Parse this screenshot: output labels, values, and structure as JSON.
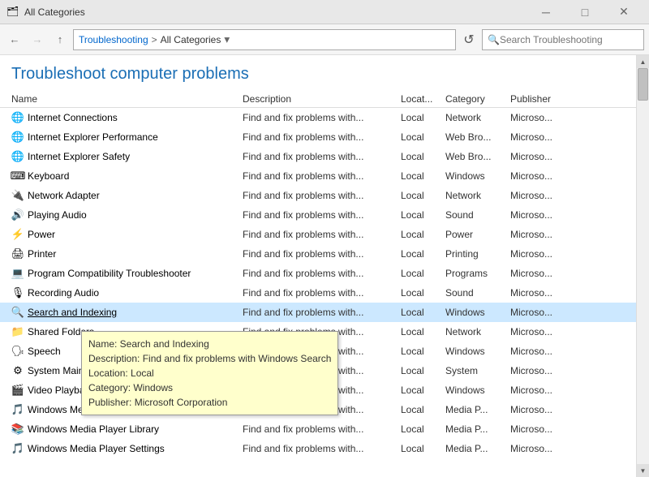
{
  "titleBar": {
    "icon": "🗂",
    "title": "All Categories",
    "minBtn": "─",
    "maxBtn": "□",
    "closeBtn": "✕"
  },
  "addressBar": {
    "backBtn": "←",
    "forwardBtn": "→",
    "upBtn": "↑",
    "breadcrumb": {
      "path1": "Troubleshooting",
      "sep": ">",
      "path2": "All Categories"
    },
    "dropdownBtn": "▾",
    "refreshBtn": "↺",
    "searchPlaceholder": "Search Troubleshooting"
  },
  "pageTitle": "Troubleshoot computer problems",
  "columns": {
    "name": "Name",
    "description": "Description",
    "location": "Locat...",
    "category": "Category",
    "publisher": "Publisher"
  },
  "items": [
    {
      "icon": "🌐",
      "name": "Internet Connections",
      "desc": "Find and fix problems with...",
      "loc": "Local",
      "cat": "Network",
      "pub": "Microso..."
    },
    {
      "icon": "🌐",
      "name": "Internet Explorer Performance",
      "desc": "Find and fix problems with...",
      "loc": "Local",
      "cat": "Web Bro...",
      "pub": "Microso..."
    },
    {
      "icon": "🌐",
      "name": "Internet Explorer Safety",
      "desc": "Find and fix problems with...",
      "loc": "Local",
      "cat": "Web Bro...",
      "pub": "Microso..."
    },
    {
      "icon": "⌨",
      "name": "Keyboard",
      "desc": "Find and fix problems with...",
      "loc": "Local",
      "cat": "Windows",
      "pub": "Microso..."
    },
    {
      "icon": "🔌",
      "name": "Network Adapter",
      "desc": "Find and fix problems with...",
      "loc": "Local",
      "cat": "Network",
      "pub": "Microso..."
    },
    {
      "icon": "🔊",
      "name": "Playing Audio",
      "desc": "Find and fix problems with...",
      "loc": "Local",
      "cat": "Sound",
      "pub": "Microso..."
    },
    {
      "icon": "⚡",
      "name": "Power",
      "desc": "Find and fix problems with...",
      "loc": "Local",
      "cat": "Power",
      "pub": "Microso..."
    },
    {
      "icon": "🖨",
      "name": "Printer",
      "desc": "Find and fix problems with...",
      "loc": "Local",
      "cat": "Printing",
      "pub": "Microso..."
    },
    {
      "icon": "💻",
      "name": "Program Compatibility Troubleshooter",
      "desc": "Find and fix problems with...",
      "loc": "Local",
      "cat": "Programs",
      "pub": "Microso..."
    },
    {
      "icon": "🎙",
      "name": "Recording Audio",
      "desc": "Find and fix problems with...",
      "loc": "Local",
      "cat": "Sound",
      "pub": "Microso..."
    },
    {
      "icon": "🔍",
      "name": "Search and Indexing",
      "desc": "Find and fix problems with...",
      "loc": "Local",
      "cat": "Windows",
      "pub": "Microso...",
      "selected": true
    },
    {
      "icon": "📁",
      "name": "Shared Folders",
      "desc": "Find and fix problems with...",
      "loc": "Local",
      "cat": "Network",
      "pub": "Microso..."
    },
    {
      "icon": "🗣",
      "name": "Speech",
      "desc": "Find and fix problems with...",
      "loc": "Local",
      "cat": "Windows",
      "pub": "Microso..."
    },
    {
      "icon": "⚙",
      "name": "System Maintenance",
      "desc": "Find and fix problems with...",
      "loc": "Local",
      "cat": "System",
      "pub": "Microso..."
    },
    {
      "icon": "🎬",
      "name": "Video Playback",
      "desc": "Find and fix problems with...",
      "loc": "Local",
      "cat": "Windows",
      "pub": "Microso..."
    },
    {
      "icon": "🎵",
      "name": "Windows Media Player Settings",
      "desc": "Find and fix problems with...",
      "loc": "Local",
      "cat": "Media P...",
      "pub": "Microso..."
    },
    {
      "icon": "📚",
      "name": "Windows Media Player Library",
      "desc": "Find and fix problems with...",
      "loc": "Local",
      "cat": "Media P...",
      "pub": "Microso..."
    },
    {
      "icon": "🎵",
      "name": "Windows Media Player Settings",
      "desc": "Find and fix problems with...",
      "loc": "Local",
      "cat": "Media P...",
      "pub": "Microso..."
    }
  ],
  "tooltip": {
    "nameLine": "Name: Search and Indexing",
    "descLine": "Description: Find and fix problems with Windows Search",
    "locLine": "Location: Local",
    "catLine": "Category: Windows",
    "pubLine": "Publisher: Microsoft Corporation"
  }
}
